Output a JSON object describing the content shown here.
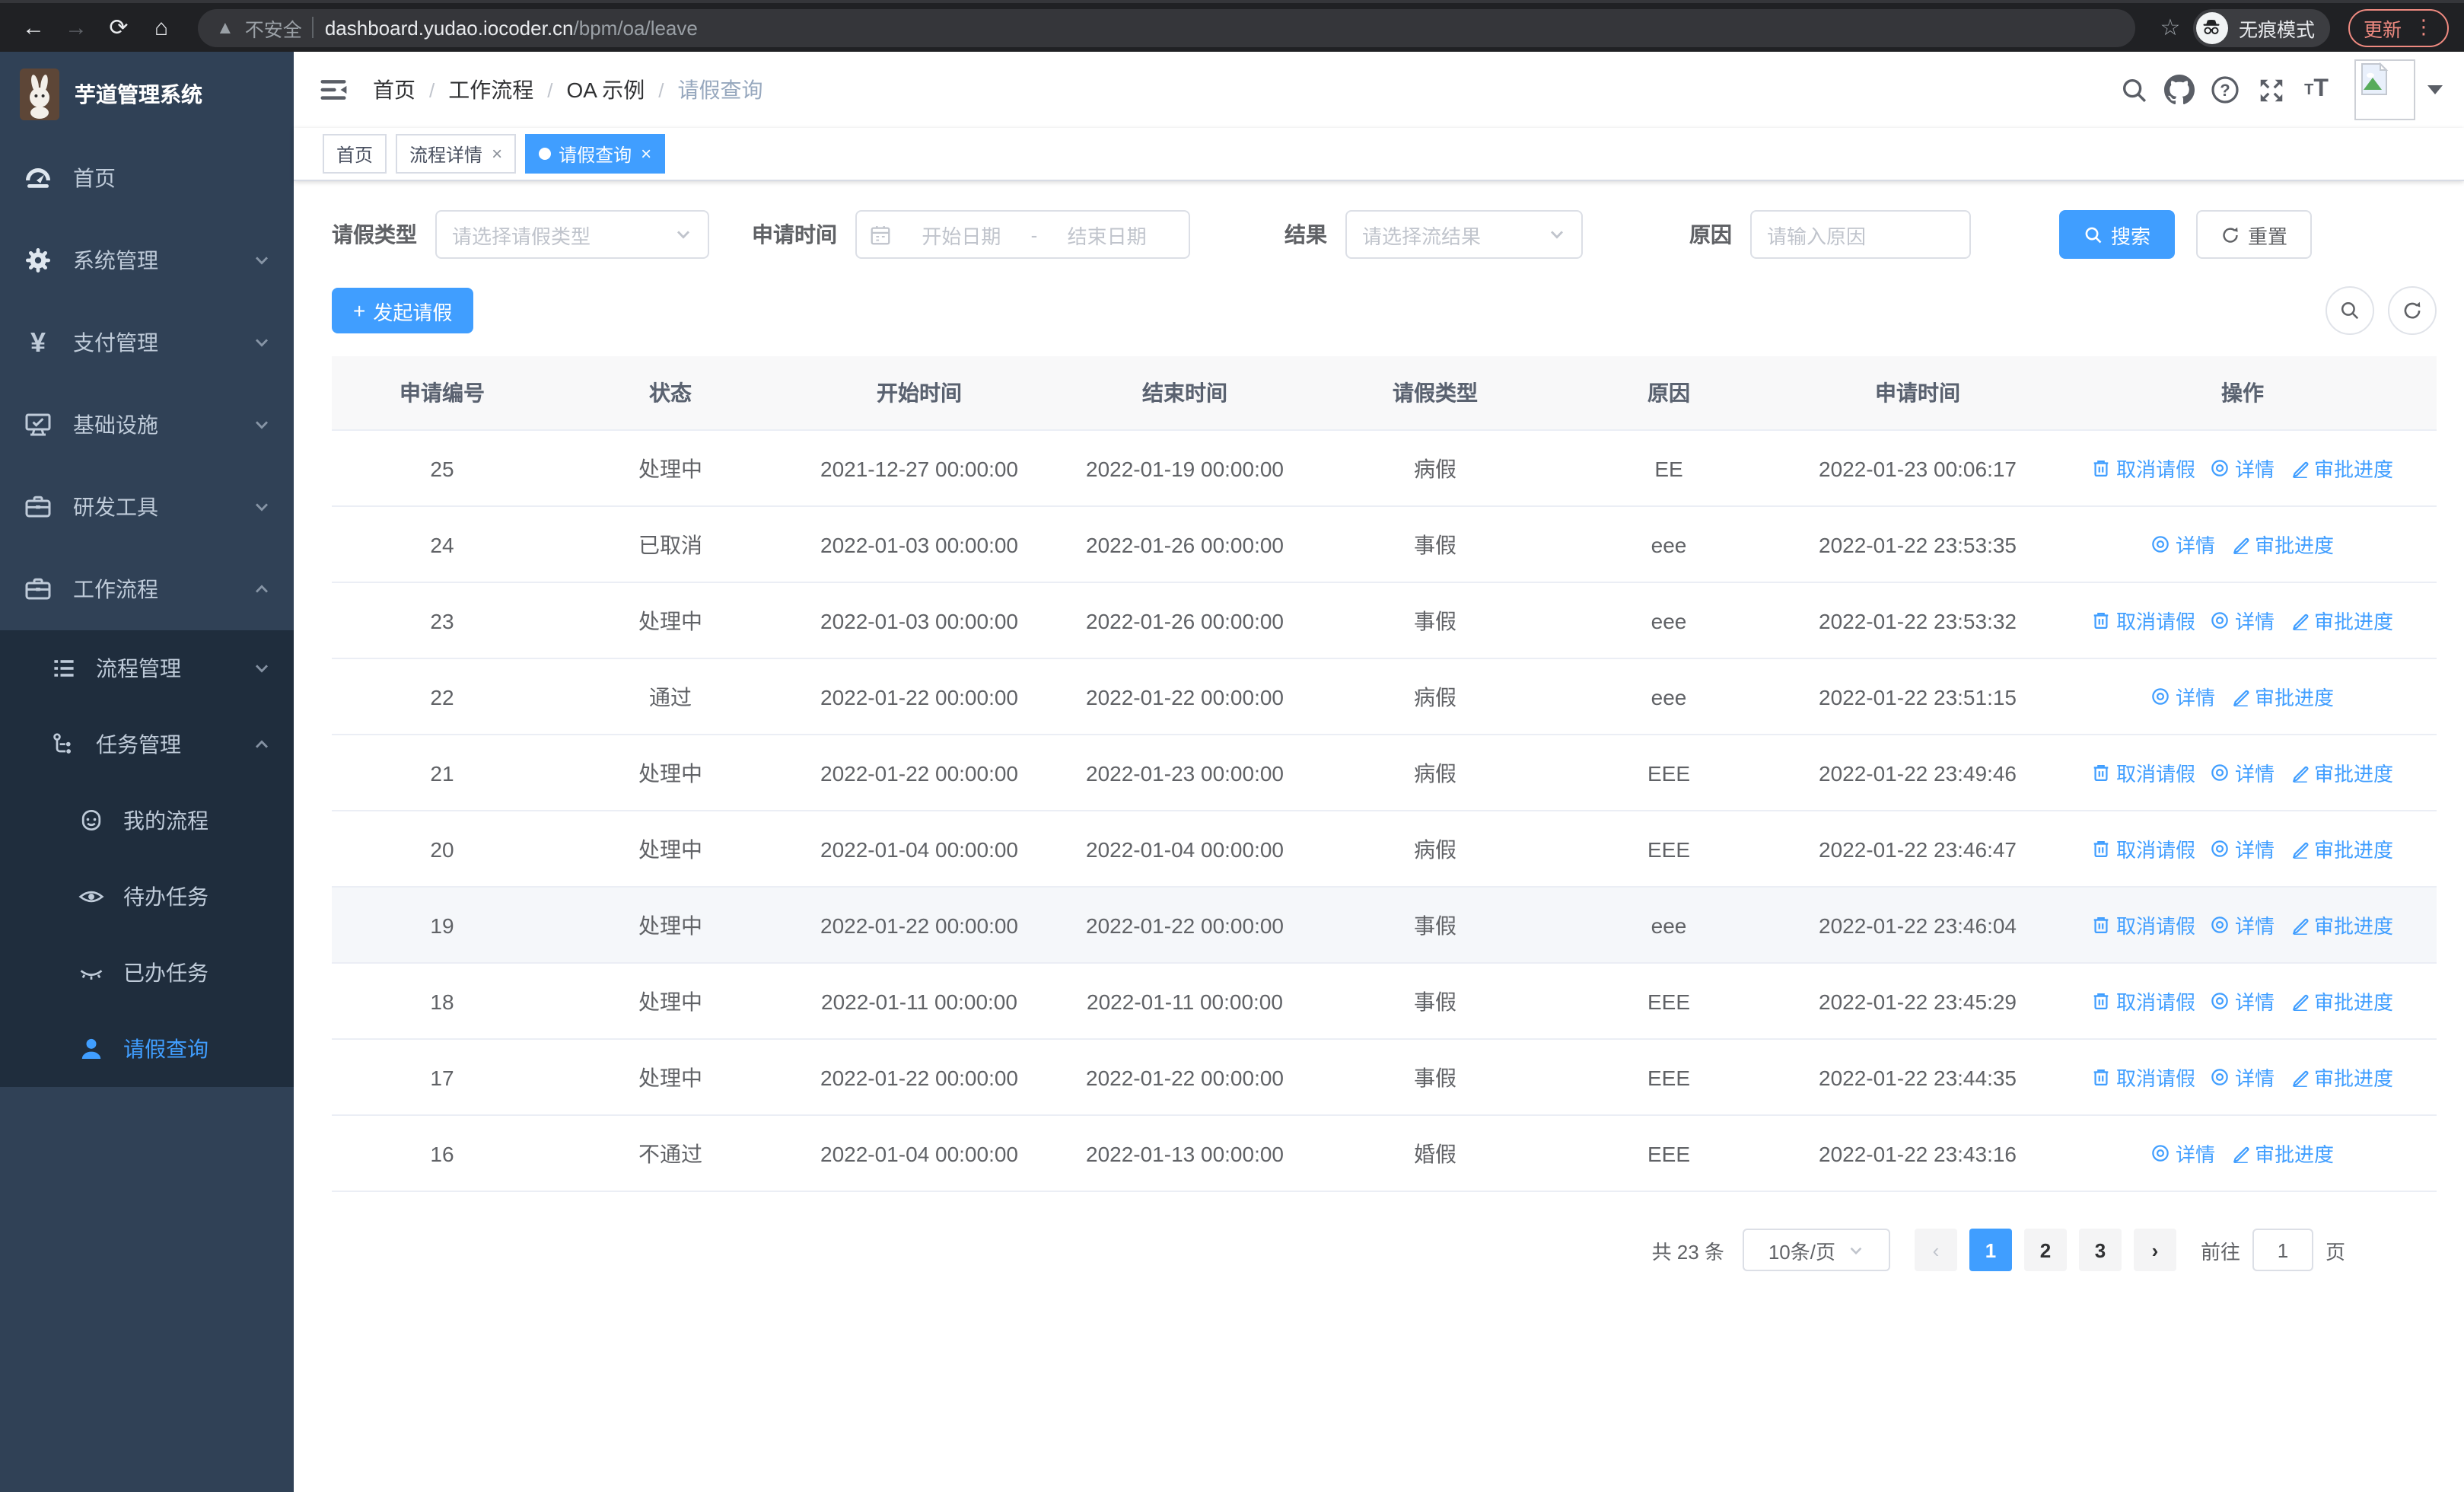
{
  "browser": {
    "security_label": "不安全",
    "url_host": "dashboard.yudao.iocoder.cn",
    "url_path": "/bpm/oa/leave",
    "incognito_label": "无痕模式",
    "update_label": "更新"
  },
  "sidebar": {
    "logo_title": "芋道管理系统",
    "menu": [
      {
        "label": "首页",
        "icon": "dashboard-icon",
        "chevron": null
      },
      {
        "label": "系统管理",
        "icon": "gear-icon",
        "chevron": "down"
      },
      {
        "label": "支付管理",
        "icon": "yuan-icon",
        "chevron": "down"
      },
      {
        "label": "基础设施",
        "icon": "monitor-icon",
        "chevron": "down"
      },
      {
        "label": "研发工具",
        "icon": "toolbox-icon",
        "chevron": "down"
      },
      {
        "label": "工作流程",
        "icon": "briefcase-icon",
        "chevron": "up"
      }
    ],
    "submenu": [
      {
        "label": "流程管理",
        "icon": "list-icon",
        "chevron": "down"
      },
      {
        "label": "任务管理",
        "icon": "flow-icon",
        "chevron": "up"
      }
    ],
    "task_children": [
      {
        "label": "我的流程",
        "icon": "robot-icon",
        "active": false
      },
      {
        "label": "待办任务",
        "icon": "eye-open-icon",
        "active": false
      },
      {
        "label": "已办任务",
        "icon": "eye-closed-icon",
        "active": false
      },
      {
        "label": "请假查询",
        "icon": "user-icon",
        "active": true
      }
    ]
  },
  "header": {
    "breadcrumbs": [
      "首页",
      "工作流程",
      "OA 示例",
      "请假查询"
    ]
  },
  "tabs": [
    {
      "label": "首页",
      "closable": false,
      "active": false
    },
    {
      "label": "流程详情",
      "closable": true,
      "active": false
    },
    {
      "label": "请假查询",
      "closable": true,
      "active": true
    }
  ],
  "filters": {
    "leave_type_label": "请假类型",
    "leave_type_placeholder": "请选择请假类型",
    "apply_time_label": "申请时间",
    "start_date_placeholder": "开始日期",
    "date_separator": "-",
    "end_date_placeholder": "结束日期",
    "result_label": "结果",
    "result_placeholder": "请选择流结果",
    "reason_label": "原因",
    "reason_placeholder": "请输入原因",
    "search_label": "搜索",
    "reset_label": "重置"
  },
  "toolbar": {
    "create_label": "发起请假"
  },
  "table": {
    "columns": [
      "申请编号",
      "状态",
      "开始时间",
      "结束时间",
      "请假类型",
      "原因",
      "申请时间",
      "操作"
    ],
    "action_labels": {
      "cancel": "取消请假",
      "detail": "详情",
      "progress": "审批进度"
    },
    "rows": [
      {
        "id": "25",
        "status": "处理中",
        "start": "2021-12-27 00:00:00",
        "end": "2022-01-19 00:00:00",
        "type": "病假",
        "reason": "EE",
        "applied": "2022-01-23 00:06:17",
        "cancellable": true,
        "highlight": false
      },
      {
        "id": "24",
        "status": "已取消",
        "start": "2022-01-03 00:00:00",
        "end": "2022-01-26 00:00:00",
        "type": "事假",
        "reason": "eee",
        "applied": "2022-01-22 23:53:35",
        "cancellable": false,
        "highlight": false
      },
      {
        "id": "23",
        "status": "处理中",
        "start": "2022-01-03 00:00:00",
        "end": "2022-01-26 00:00:00",
        "type": "事假",
        "reason": "eee",
        "applied": "2022-01-22 23:53:32",
        "cancellable": true,
        "highlight": false
      },
      {
        "id": "22",
        "status": "通过",
        "start": "2022-01-22 00:00:00",
        "end": "2022-01-22 00:00:00",
        "type": "病假",
        "reason": "eee",
        "applied": "2022-01-22 23:51:15",
        "cancellable": false,
        "highlight": false
      },
      {
        "id": "21",
        "status": "处理中",
        "start": "2022-01-22 00:00:00",
        "end": "2022-01-23 00:00:00",
        "type": "病假",
        "reason": "EEE",
        "applied": "2022-01-22 23:49:46",
        "cancellable": true,
        "highlight": false
      },
      {
        "id": "20",
        "status": "处理中",
        "start": "2022-01-04 00:00:00",
        "end": "2022-01-04 00:00:00",
        "type": "病假",
        "reason": "EEE",
        "applied": "2022-01-22 23:46:47",
        "cancellable": true,
        "highlight": false
      },
      {
        "id": "19",
        "status": "处理中",
        "start": "2022-01-22 00:00:00",
        "end": "2022-01-22 00:00:00",
        "type": "事假",
        "reason": "eee",
        "applied": "2022-01-22 23:46:04",
        "cancellable": true,
        "highlight": true
      },
      {
        "id": "18",
        "status": "处理中",
        "start": "2022-01-11 00:00:00",
        "end": "2022-01-11 00:00:00",
        "type": "事假",
        "reason": "EEE",
        "applied": "2022-01-22 23:45:29",
        "cancellable": true,
        "highlight": false
      },
      {
        "id": "17",
        "status": "处理中",
        "start": "2022-01-22 00:00:00",
        "end": "2022-01-22 00:00:00",
        "type": "事假",
        "reason": "EEE",
        "applied": "2022-01-22 23:44:35",
        "cancellable": true,
        "highlight": false
      },
      {
        "id": "16",
        "status": "不通过",
        "start": "2022-01-04 00:00:00",
        "end": "2022-01-13 00:00:00",
        "type": "婚假",
        "reason": "EEE",
        "applied": "2022-01-22 23:43:16",
        "cancellable": false,
        "highlight": false
      }
    ]
  },
  "pagination": {
    "total_label": "共 23 条",
    "page_size_label": "10条/页",
    "pages": [
      "1",
      "2",
      "3"
    ],
    "active_page": "1",
    "goto_label": "前往",
    "goto_value": "1",
    "page_suffix_label": "页"
  },
  "icons": {
    "browser": [
      "back-icon",
      "forward-icon",
      "reload-icon",
      "home-icon",
      "warning-icon",
      "bookmark-star-icon",
      "incognito-icon",
      "kebab-menu-icon"
    ],
    "navbar": [
      "hamburger-icon",
      "search-icon",
      "github-icon",
      "help-icon",
      "fullscreen-icon",
      "font-size-icon",
      "avatar-placeholder-icon",
      "caret-down-icon"
    ],
    "actions": [
      "trash-icon",
      "view-icon",
      "pen-icon"
    ]
  },
  "colors": {
    "primary": "#409EFF",
    "sidebar_bg": "#304156",
    "submenu_bg": "#1f2d3d",
    "browser_bar_bg": "#202124",
    "update_accent": "#ef8a80",
    "table_header_bg": "#f8f8f9"
  }
}
